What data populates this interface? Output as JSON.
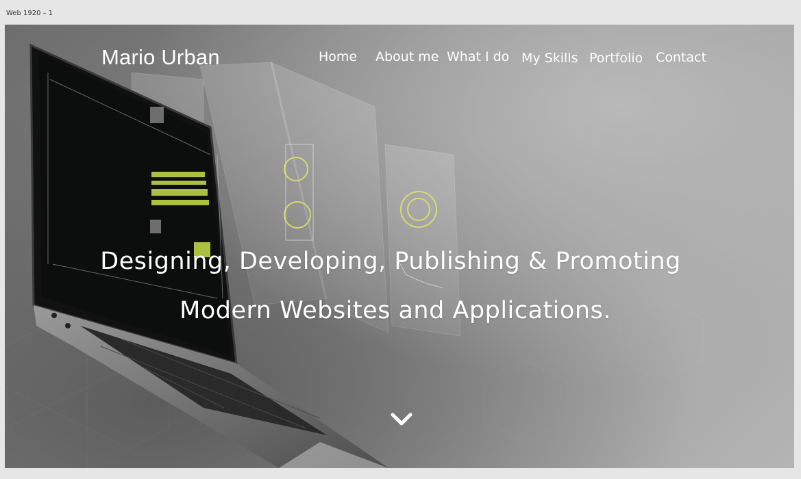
{
  "artboard": {
    "label": "Web 1920 – 1"
  },
  "header": {
    "brand": "Mario Urban",
    "nav": [
      {
        "label": "Home"
      },
      {
        "label": "About me"
      },
      {
        "label": "What I do"
      },
      {
        "label": "My Skills"
      },
      {
        "label": "Portfolio"
      },
      {
        "label": "Contact"
      }
    ]
  },
  "hero": {
    "line1": "Designing, Developing, Publishing & Promoting",
    "line2": "Modern Websites and Applications.",
    "image": "laptop-with-floating-dashboard-panels",
    "scroll_icon": "chevron-down-icon"
  },
  "colors": {
    "text": "#ffffff",
    "background_dark": "#6d6d6d",
    "background_light": "#b4b4b4",
    "accent_screen": "#c8e04a"
  }
}
